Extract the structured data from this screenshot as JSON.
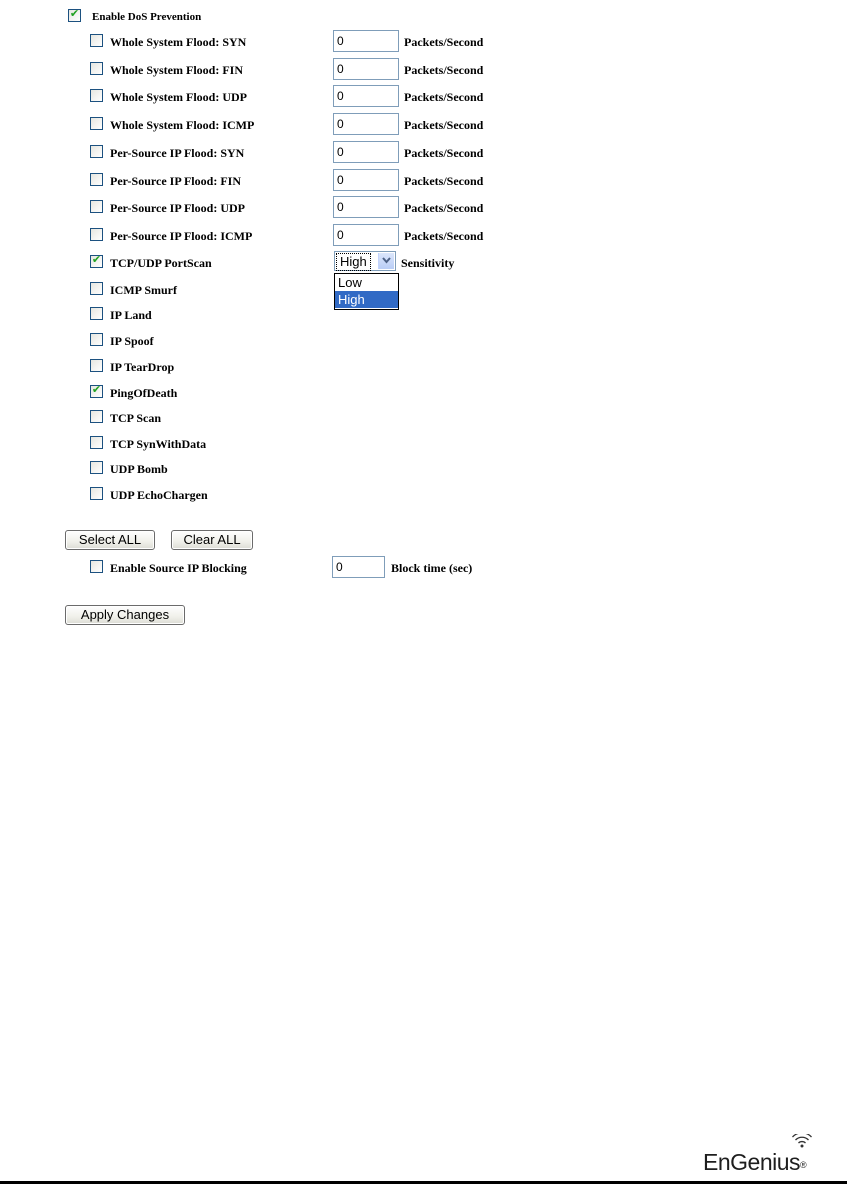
{
  "dos": {
    "enable_label": "Enable DoS Prevention",
    "enable_checked": true,
    "flood_unit": "Packets/Second",
    "floods": [
      {
        "label": "Whole System Flood: SYN",
        "value": "0",
        "checked": false
      },
      {
        "label": "Whole System Flood: FIN",
        "value": "0",
        "checked": false
      },
      {
        "label": "Whole System Flood: UDP",
        "value": "0",
        "checked": false
      },
      {
        "label": "Whole System Flood: ICMP",
        "value": "0",
        "checked": false
      },
      {
        "label": "Per-Source IP Flood: SYN",
        "value": "0",
        "checked": false
      },
      {
        "label": "Per-Source IP Flood: FIN",
        "value": "0",
        "checked": false
      },
      {
        "label": "Per-Source IP Flood: UDP",
        "value": "0",
        "checked": false
      },
      {
        "label": "Per-Source IP Flood: ICMP",
        "value": "0",
        "checked": false
      }
    ],
    "portscan": {
      "label": "TCP/UDP PortScan",
      "checked": true,
      "selected": "High",
      "options": [
        "Low",
        "High"
      ],
      "suffix": "Sensitivity"
    },
    "attacks": [
      {
        "label": "ICMP Smurf",
        "checked": false
      },
      {
        "label": "IP Land",
        "checked": false
      },
      {
        "label": "IP Spoof",
        "checked": false
      },
      {
        "label": "IP TearDrop",
        "checked": false
      },
      {
        "label": "PingOfDeath",
        "checked": true
      },
      {
        "label": "TCP Scan",
        "checked": false
      },
      {
        "label": "TCP SynWithData",
        "checked": false
      },
      {
        "label": "UDP Bomb",
        "checked": false
      },
      {
        "label": "UDP EchoChargen",
        "checked": false
      }
    ]
  },
  "buttons": {
    "select_all": "Select ALL",
    "clear_all": "Clear ALL",
    "apply": "Apply Changes"
  },
  "blocking": {
    "label": "Enable Source IP Blocking",
    "checked": false,
    "value": "0",
    "unit": "Block time (sec)"
  },
  "footer": {
    "logo_text": "EnGenius",
    "logo_mark": "®"
  },
  "icons": {
    "check": "checkmark-icon",
    "dropdown": "chevron-down-icon",
    "wifi": "wifi-signal-icon"
  },
  "colors": {
    "selected_option": "#316ac5",
    "checkmark": "#21a121",
    "field_border": "#7f9db9"
  }
}
